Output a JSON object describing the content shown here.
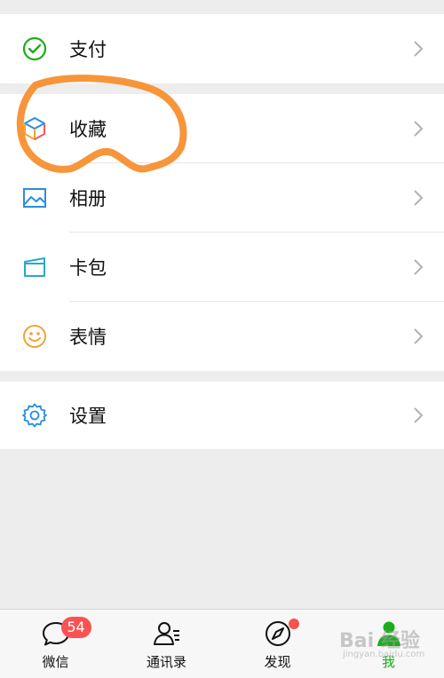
{
  "menu": {
    "pay": {
      "label": "支付",
      "icon": "wallet-check-icon"
    },
    "favorites": {
      "label": "收藏",
      "icon": "cube-icon"
    },
    "album": {
      "label": "相册",
      "icon": "photo-icon"
    },
    "cards": {
      "label": "卡包",
      "icon": "card-wallet-icon"
    },
    "stickers": {
      "label": "表情",
      "icon": "smiley-icon"
    },
    "settings": {
      "label": "设置",
      "icon": "gear-icon"
    }
  },
  "tabs": [
    {
      "label": "微信",
      "icon": "chat-bubble-icon",
      "badge": "54"
    },
    {
      "label": "通讯录",
      "icon": "contacts-icon"
    },
    {
      "label": "发现",
      "icon": "compass-icon",
      "dot": true
    },
    {
      "label": "我",
      "icon": "person-icon",
      "active": true
    }
  ],
  "watermark": {
    "brand": "Bai 经验",
    "url": "jingyan.baidu.com"
  },
  "colors": {
    "accent_green": "#1aad19",
    "badge_red": "#fa5151",
    "annotation_orange": "#f7953a",
    "background": "#ededed"
  }
}
